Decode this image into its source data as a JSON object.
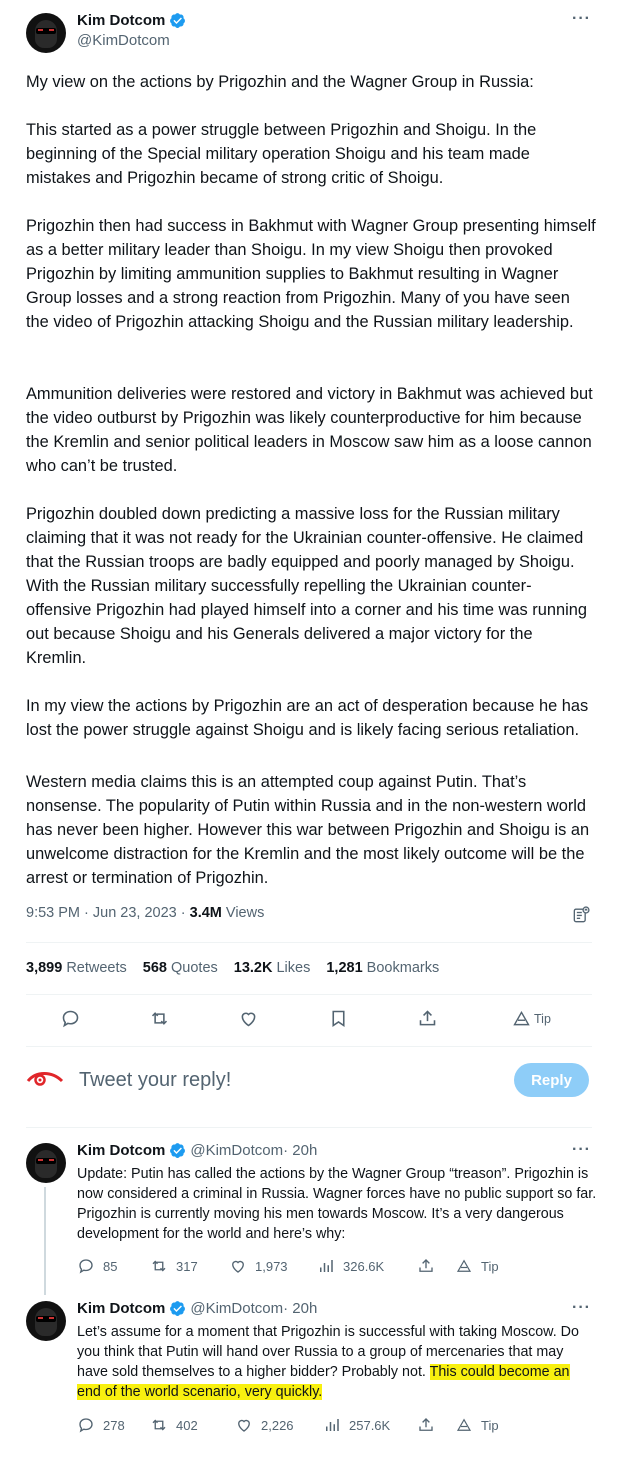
{
  "author": {
    "name": "Kim Dotcom",
    "handle": "@KimDotcom"
  },
  "tweet": {
    "paragraphs": [
      "My view on the actions by Prigozhin and the Wagner Group in Russia:",
      "This started as a power struggle between Prigozhin and Shoigu. In the beginning of the Special military operation Shoigu and his team made mistakes and Prigozhin became of strong critic of Shoigu.",
      "Prigozhin then had success in Bakhmut with Wagner Group presenting himself as a better military leader than Shoigu. In my view Shoigu then provoked Prigozhin by limiting ammunition supplies to Bakhmut resulting in Wagner Group losses and a strong reaction from Prigozhin. Many of you have seen the video of Prigozhin attacking Shoigu and the Russian military leadership.",
      "Ammunition deliveries were restored and victory in Bakhmut was achieved but the video outburst by Prigozhin was likely counterproductive for him because the Kremlin and senior political leaders in Moscow saw him as a loose cannon who can’t be trusted.",
      "Prigozhin doubled down predicting a massive loss for the Russian military claiming that it was not ready for the Ukrainian counter-offensive. He claimed that the Russian troops are badly equipped and poorly managed by Shoigu. With the Russian military successfully repelling the Ukrainian counter-offensive Prigozhin had played himself into a corner and his time was running out because Shoigu and his Generals delivered a major victory for the Kremlin.",
      "In my view the actions by Prigozhin are an act of desperation because he has lost the power struggle against Shoigu and is likely facing serious retaliation.",
      "Western media claims this is an attempted coup against Putin. That’s nonsense. The popularity of Putin within Russia and in the non-western world has never been higher. However this war between Prigozhin and Shoigu is an unwelcome distraction for the Kremlin and the most likely outcome will be the arrest or termination of Prigozhin."
    ],
    "timestamp": "9:53 PM · Jun 23, 2023 · ",
    "views_count": "3.4M",
    "views_label": " Views",
    "stats": {
      "retweets_count": "3,899",
      "retweets_label": " Retweets",
      "quotes_count": "568",
      "quotes_label": " Quotes",
      "likes_count": "13.2K",
      "likes_label": " Likes",
      "bookmarks_count": "1,281",
      "bookmarks_label": " Bookmarks"
    },
    "tip_label": "Tip"
  },
  "reply_box": {
    "placeholder": "Tweet your reply!",
    "button_label": "Reply"
  },
  "replies": [
    {
      "name": "Kim Dotcom",
      "handle": "@KimDotcom",
      "age": " · 20h",
      "text": "Update: Putin has called the actions by the Wagner Group “treason”. Prigozhin is now considered a criminal in Russia. Wagner forces have no public support so far. Prigozhin is currently moving his men towards Moscow. It’s a very dangerous development for the world and here’s why:",
      "highlight": "",
      "replies": "85",
      "retweets": "317",
      "likes": "1,973",
      "views": "326.6K",
      "tip": "Tip"
    },
    {
      "name": "Kim Dotcom",
      "handle": "@KimDotcom",
      "age": " · 20h",
      "text": "Let’s assume for a moment that Prigozhin is successful with taking Moscow. Do you think that Putin will hand over Russia to a group of mercenaries that may have sold themselves to a higher bidder? Probably not. ",
      "highlight": "This could become an end of the world scenario, very quickly.",
      "replies": "278",
      "retweets": "402",
      "likes": "2,226",
      "views": "257.6K",
      "tip": "Tip"
    }
  ],
  "colors": {
    "verified_blue": "#1d9bf0",
    "muted_text": "#536471",
    "reply_button": "#8ecdf8",
    "highlight": "#f8f00f"
  }
}
